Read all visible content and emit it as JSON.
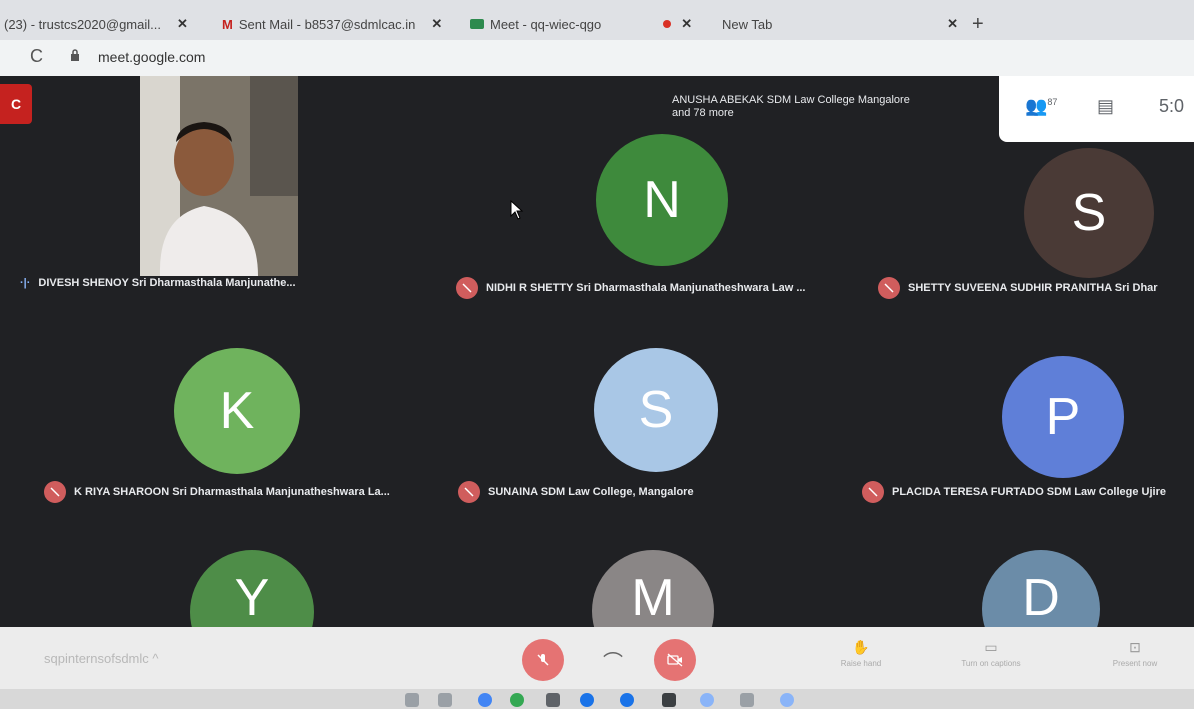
{
  "browser": {
    "tabs": [
      {
        "label": "(23) - trustcs2020@gmail..."
      },
      {
        "label": "Sent Mail - b8537@sdmlcac.in"
      },
      {
        "label": "Meet - qq-wiec-qgo"
      },
      {
        "label": "New Tab"
      }
    ],
    "url": "meet.google.com"
  },
  "meeting": {
    "rec_badge": "C",
    "presenting_text_1": "ANUSHA ABEKAK SDM Law College Mangalore",
    "presenting_text_2": "and 78 more",
    "participant_count": "87",
    "time": "5:0",
    "code": "sqpinternsofsdmlc",
    "participants": [
      {
        "name": "DIVESH SHENOY Sri Dharmasthala Manjunathe...",
        "initial": "",
        "color": ""
      },
      {
        "name": "NIDHI R SHETTY Sri Dharmasthala Manjunatheshwara Law ...",
        "initial": "N",
        "color": "#3e8a3c"
      },
      {
        "name": "SHETTY SUVEENA SUDHIR PRANITHA Sri Dhar",
        "initial": "S",
        "color": "#4a3a36"
      },
      {
        "name": "K RIYA SHAROON Sri Dharmasthala Manjunatheshwara La...",
        "initial": "K",
        "color": "#6fb35d"
      },
      {
        "name": "SUNAINA SDM Law College, Mangalore",
        "initial": "S",
        "color": "#a9c7e6"
      },
      {
        "name": "PLACIDA TERESA FURTADO SDM Law College Ujire",
        "initial": "P",
        "color": "#5f7fd8"
      },
      {
        "name": "",
        "initial": "Y",
        "color": "#4e8d48"
      },
      {
        "name": "",
        "initial": "M",
        "color": "#8a8686"
      },
      {
        "name": "",
        "initial": "D",
        "color": "#6b8ca8"
      }
    ],
    "controls": {
      "raise_hand": "Raise hand",
      "turn_on_captions": "Turn on captions",
      "present_now": "Present now"
    }
  }
}
